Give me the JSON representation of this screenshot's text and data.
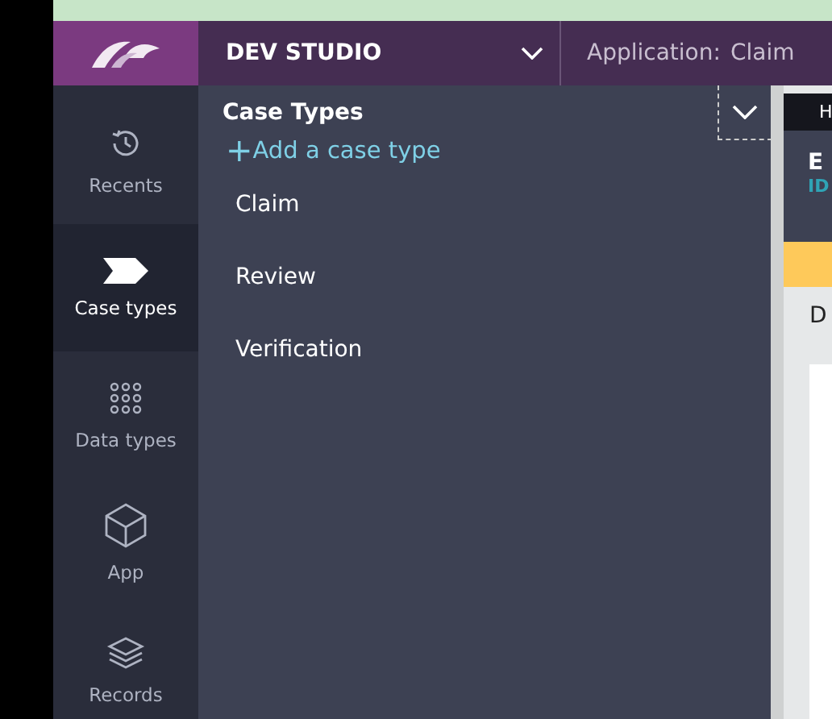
{
  "header": {
    "studio": "DEV STUDIO",
    "application_label": "Application:",
    "application_name": "Claim"
  },
  "nav": [
    {
      "label": "Recents",
      "selected": false
    },
    {
      "label": "Case types",
      "selected": true
    },
    {
      "label": "Data types",
      "selected": false
    },
    {
      "label": "App",
      "selected": false
    },
    {
      "label": "Records",
      "selected": false
    }
  ],
  "panel": {
    "title": "Case Types",
    "add_label": "Add a case type",
    "add_icon": "+",
    "items": [
      "Claim",
      "Review",
      "Verification"
    ]
  },
  "content": {
    "tab": "H",
    "title": "E",
    "subtitle": "ID",
    "section": "D"
  }
}
